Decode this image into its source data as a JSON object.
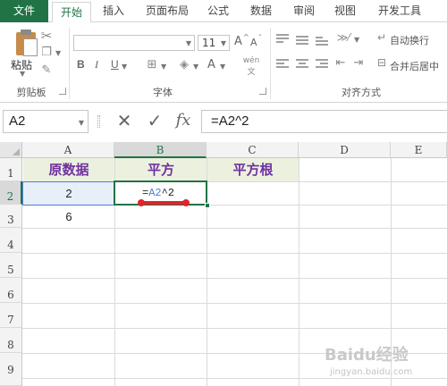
{
  "ribbon": {
    "tabs": [
      "文件",
      "开始",
      "插入",
      "页面布局",
      "公式",
      "数据",
      "审阅",
      "视图",
      "开发工具"
    ],
    "active_tab": "开始",
    "clipboard": {
      "paste_label": "粘贴",
      "group_label": "剪贴板"
    },
    "font": {
      "name": "",
      "size": "11",
      "group_label": "字体",
      "bold": "B",
      "italic": "I",
      "underline": "U",
      "grow": "A",
      "shrink": "A",
      "font_color": "A"
    },
    "alignment": {
      "wrap_label": "自动换行",
      "merge_label": "合并后居中",
      "group_label": "对齐方式"
    }
  },
  "formula_bar": {
    "name_box": "A2",
    "cancel": "✕",
    "enter": "✓",
    "fx": "fx",
    "formula": "=A2^2"
  },
  "sheet": {
    "columns": [
      "A",
      "B",
      "C",
      "D",
      "E"
    ],
    "rows": [
      "1",
      "2",
      "3",
      "4",
      "5",
      "6",
      "7",
      "8",
      "9"
    ],
    "header": {
      "a1": "原数据",
      "b1": "平方",
      "c1": "平方根"
    },
    "a2": "2",
    "a3": "6",
    "b2_formula": {
      "prefix": "=",
      "ref": "A2",
      "suffix": "^2"
    }
  },
  "watermark": {
    "main": "Baidu经验",
    "sub": "jingyan.baidu.com"
  },
  "colors": {
    "accent": "#217346",
    "header_fill": "#ebf1de",
    "header_text": "#7030a0",
    "ref_blue": "#4a7fd4",
    "mark_red": "#e0242b"
  }
}
